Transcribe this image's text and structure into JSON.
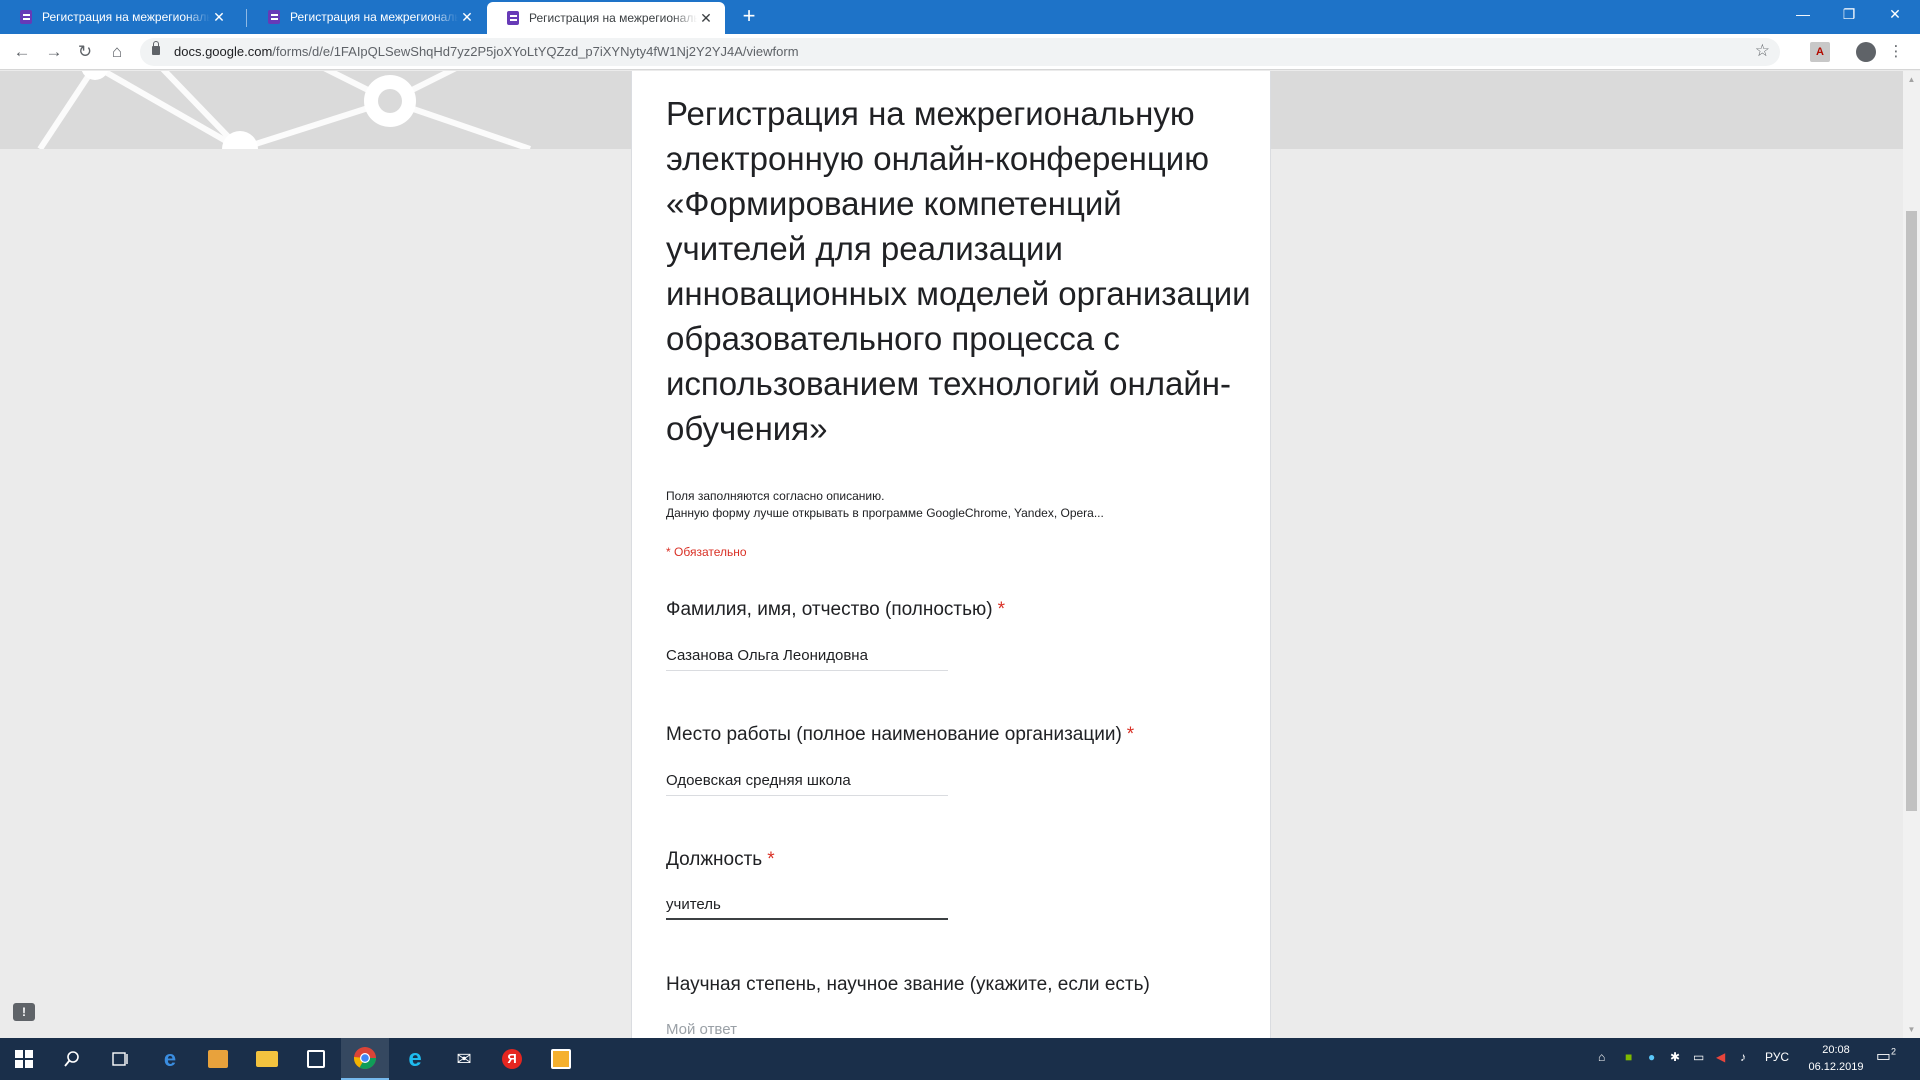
{
  "browser": {
    "tabs": [
      {
        "title": "Регистрация на межрегиональную"
      },
      {
        "title": "Регистрация на межрегиональную"
      },
      {
        "title": "Регистрация на межрегиональную"
      }
    ],
    "url_host": "docs.google.com",
    "url_path": "/forms/d/e/1FAIpQLSewShqHd7yz2P5joXYoLtYQZzd_p7iXYNyty4fW1Nj2Y2YJ4A/viewform"
  },
  "form": {
    "title": "Регистрация на межрегиональную электронную онлайн-конференцию «Формирование компетенций учителей для реализации инновационных моделей организации образовательного процесса с использованием технологий онлайн-обучения»",
    "description_line1": "Поля заполняются согласно описанию.",
    "description_line2": "Данную форму лучше открывать в программе GoogleChrome, Yandex, Opera...",
    "required_note": "* Обязательно",
    "questions": [
      {
        "label": "Фамилия, имя, отчество (полностью)",
        "star": "*",
        "value": "Сазанова Ольга Леонидовна"
      },
      {
        "label": "Место работы (полное наименование организации)",
        "star": "*",
        "value": "Одоевская средняя школа"
      },
      {
        "label": "Должность",
        "star": "*",
        "value": "учитель"
      },
      {
        "label": "Научная степень, научное звание (укажите, если есть)",
        "placeholder": "Мой ответ"
      }
    ]
  },
  "taskbar": {
    "language": "РУС",
    "time": "20:08",
    "date": "06.12.2019",
    "notification_count": "2"
  },
  "colors": {
    "accent": "#673ab7",
    "required": "#d93025",
    "titlebar": "#1e73c8",
    "taskbar": "#1a2f4a"
  }
}
